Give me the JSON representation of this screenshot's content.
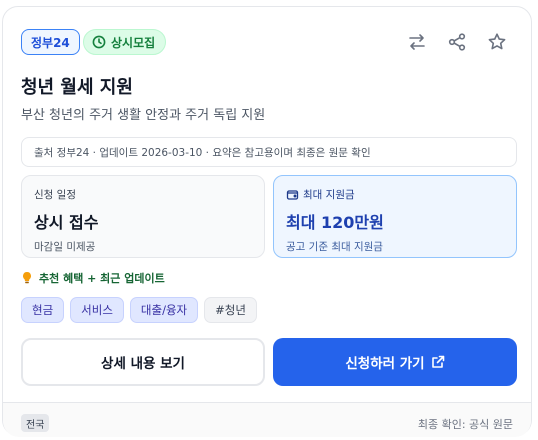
{
  "badges": {
    "gov": "정부24",
    "status": "상시모집"
  },
  "icons": {
    "status": "clock-icon",
    "compare": "swap-arrows-icon",
    "share": "share-icon",
    "bookmark": "star-icon",
    "budget": "wallet-icon",
    "reco": "lightbulb-icon",
    "external": "external-link-icon"
  },
  "title": "청년 월세 지원",
  "subtitle": "부산 청년의 주거 생활 안정과 주거 독립 지원",
  "source_line": "출처 정부24 · 업데이트 2026-03-10 · 요약은 참고용이며 최종은 원문 확인",
  "schedule": {
    "label": "신청 일정",
    "value": "상시 접수",
    "note": "마감일 미제공"
  },
  "budget": {
    "label": "최대 지원금",
    "value": "최대 120만원",
    "note": "공고 기준 최대 지원금"
  },
  "recommendation": "추천 혜택 + 최근 업데이트",
  "tags": [
    "현금",
    "서비스",
    "대출/융자",
    "#청년"
  ],
  "buttons": {
    "detail": "상세 내용 보기",
    "apply": "신청하러 가기"
  },
  "footer": {
    "region": "전국",
    "final_check": "최종 확인: 공식 원문"
  },
  "colors": {
    "primary": "#2563eb",
    "status_green": "#15803d",
    "gov_blue": "#1d4ed8"
  }
}
